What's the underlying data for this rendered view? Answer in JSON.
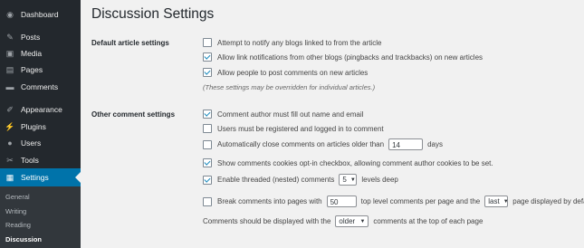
{
  "sidebar": {
    "items": [
      {
        "label": "Dashboard",
        "icon": "dashboard-icon",
        "glyph": "◉"
      },
      {
        "label": "Posts",
        "icon": "pin-icon",
        "glyph": "✎"
      },
      {
        "label": "Media",
        "icon": "media-icon",
        "glyph": "▣"
      },
      {
        "label": "Pages",
        "icon": "page-icon",
        "glyph": "▤"
      },
      {
        "label": "Comments",
        "icon": "comment-icon",
        "glyph": "▬"
      },
      {
        "label": "Appearance",
        "icon": "brush-icon",
        "glyph": "✐"
      },
      {
        "label": "Plugins",
        "icon": "plug-icon",
        "glyph": "⚡"
      },
      {
        "label": "Users",
        "icon": "users-icon",
        "glyph": "●"
      },
      {
        "label": "Tools",
        "icon": "wrench-icon",
        "glyph": "✂"
      },
      {
        "label": "Settings",
        "icon": "settings-icon",
        "glyph": "▦"
      }
    ],
    "submenu": [
      "General",
      "Writing",
      "Reading",
      "Discussion"
    ]
  },
  "page": {
    "title": "Discussion Settings",
    "default_section": "Default article settings",
    "other_section": "Other comment settings",
    "default_opts": {
      "notify_blogs": "Attempt to notify any blogs linked to from the article",
      "allow_pings": "Allow link notifications from other blogs (pingbacks and trackbacks) on new articles",
      "allow_comments": "Allow people to post comments on new articles",
      "note": "(These settings may be overridden for individual articles.)"
    },
    "other_opts": {
      "require_name": "Comment author must fill out name and email",
      "registered": "Users must be registered and logged in to comment",
      "close_prefix": "Automatically close comments on articles older than",
      "close_days": "14",
      "close_suffix": "days",
      "cookies": "Show comments cookies opt-in checkbox, allowing comment author cookies to be set.",
      "threaded_prefix": "Enable threaded (nested) comments",
      "threaded_levels": "5",
      "threaded_suffix": "levels deep",
      "pages_prefix": "Break comments into pages with",
      "pages_count": "50",
      "pages_mid": "top level comments per page and the",
      "pages_which": "last",
      "pages_suffix": "page displayed by default",
      "order_prefix": "Comments should be displayed with the",
      "order_value": "older",
      "order_suffix": "comments at the top of each page"
    }
  },
  "colors": {
    "sidebar": "#23282d",
    "active": "#0073aa",
    "submenu": "#32373c",
    "background": "#f1f1f1",
    "check": "#1e8cbe"
  }
}
